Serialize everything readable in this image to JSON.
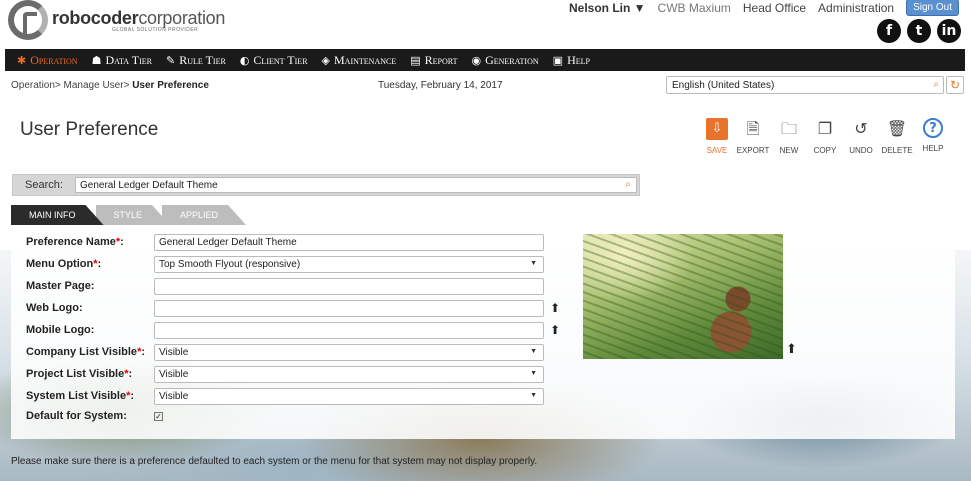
{
  "brand": {
    "name_bold": "robocoder",
    "name_rest": "corporation",
    "tagline": "GLOBAL SOLUTION PROVIDER"
  },
  "topnav": {
    "user": "Nelson Lin ▼",
    "links": [
      "CWB Maxium",
      "Head Office",
      "Administration"
    ],
    "signout": "Sign Out"
  },
  "social": {
    "facebook": "f",
    "twitter": "t",
    "linkedin": "in"
  },
  "menu": [
    {
      "label": "Operation",
      "icon": "gear-icon",
      "glyph": "✱",
      "active": true
    },
    {
      "label": "Data Tier",
      "icon": "data-tier-icon",
      "glyph": "☗"
    },
    {
      "label": "Rule Tier",
      "icon": "rule-tier-icon",
      "glyph": "✎"
    },
    {
      "label": "Client Tier",
      "icon": "client-tier-icon",
      "glyph": "◐"
    },
    {
      "label": "Maintenance",
      "icon": "maintenance-icon",
      "glyph": "◈"
    },
    {
      "label": "Report",
      "icon": "report-icon",
      "glyph": "▤"
    },
    {
      "label": "Generation",
      "icon": "generation-icon",
      "glyph": "◉"
    },
    {
      "label": "Help",
      "icon": "help-book-icon",
      "glyph": "▣"
    }
  ],
  "breadcrumb": {
    "path": "Operation> Manage User> ",
    "current": "User Preference"
  },
  "date": "Tuesday, February 14, 2017",
  "language": {
    "value": "English (United States)",
    "icon": "search-icon"
  },
  "page_title": "User Preference",
  "toolbar": [
    {
      "key": "save",
      "label": "SAVE",
      "icon": "save-icon",
      "glyph": "⇩"
    },
    {
      "key": "export",
      "label": "EXPORT",
      "icon": "export-icon",
      "glyph": "🗎"
    },
    {
      "key": "new",
      "label": "NEW",
      "icon": "new-folder-icon",
      "glyph": "🗀"
    },
    {
      "key": "copy",
      "label": "COPY",
      "icon": "copy-icon",
      "glyph": "❐"
    },
    {
      "key": "undo",
      "label": "UNDO",
      "icon": "undo-icon",
      "glyph": "↺"
    },
    {
      "key": "delete",
      "label": "DELETE",
      "icon": "trash-icon",
      "glyph": "🗑"
    },
    {
      "key": "help",
      "label": "HELP",
      "icon": "help-icon",
      "glyph": "?"
    }
  ],
  "search": {
    "label": "Search:",
    "value": "General Ledger Default Theme"
  },
  "tabs": [
    "MAIN INFO",
    "STYLE",
    "APPLIED"
  ],
  "form": {
    "preference_name": {
      "label": "Preference Name",
      "value": "General Ledger Default Theme"
    },
    "menu_option": {
      "label": "Menu Option",
      "value": "Top Smooth Flyout (responsive)"
    },
    "master_page": {
      "label": "Master Page:",
      "value": ""
    },
    "web_logo": {
      "label": "Web Logo:",
      "value": ""
    },
    "mobile_logo": {
      "label": "Mobile Logo:",
      "value": ""
    },
    "company_list_visible": {
      "label": "Company List Visible",
      "value": "Visible"
    },
    "project_list_visible": {
      "label": "Project List Visible",
      "value": "Visible"
    },
    "system_list_visible": {
      "label": "System List Visible",
      "value": "Visible"
    },
    "default_for_system": {
      "label": "Default for System:",
      "checked": true
    }
  },
  "note": "Please make sure there is a preference defaulted to each system or the menu for that system may not display properly."
}
